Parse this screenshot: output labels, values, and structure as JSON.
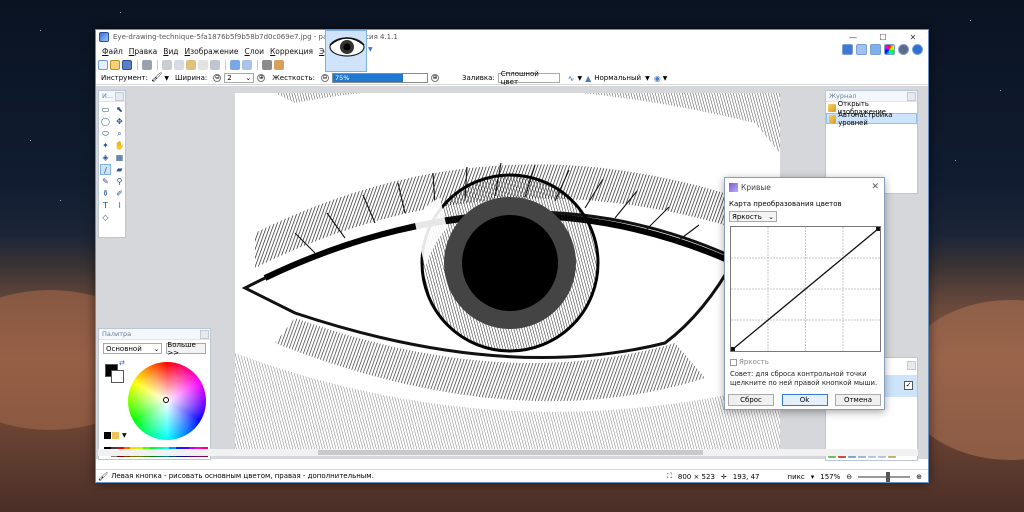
{
  "window": {
    "title": "Eye-drawing-technique-5fa1876b5f9b58b7d0c069e7.jpg - paint.net версия 4.1.1",
    "minimize": "—",
    "maximize": "☐",
    "close": "✕"
  },
  "menu": [
    "Файл",
    "Правка",
    "Вид",
    "Изображение",
    "Слои",
    "Коррекция",
    "Эффекты"
  ],
  "toolbar2": {
    "tool_label": "Инструмент:",
    "width_label": "Ширина:",
    "width_value": "2",
    "hardness_label": "Жесткость:",
    "hardness_value": "75%",
    "hardness_percent": 75,
    "fill_label": "Заливка:",
    "fill_value": "Сплошной цвет",
    "blend_value": "Нормальный",
    "minus": "⊖",
    "plus": "⊕"
  },
  "tools_panel": {
    "title": "И..."
  },
  "palette": {
    "title": "Палитра",
    "mode": "Основной",
    "more_button": "Больше >>",
    "primary_color": "#000000",
    "secondary_color": "#ffffff",
    "swatches": [
      "#000000",
      "#404040",
      "#ff0000",
      "#ff6a00",
      "#ffd800",
      "#b6ff00",
      "#4cff00",
      "#00ff21",
      "#00ff90",
      "#00ffff",
      "#0094ff",
      "#0026ff",
      "#4800ff",
      "#b200ff",
      "#ff00dc",
      "#ff006e",
      "#ffffff",
      "#808080",
      "#7f0000",
      "#7f3300",
      "#7f6a00",
      "#5b7f00",
      "#267f00",
      "#007f0e",
      "#007f46",
      "#007f7f",
      "#004a7f",
      "#00137f",
      "#21007f",
      "#57007f",
      "#7f006e",
      "#7f0037"
    ]
  },
  "history": {
    "title": "Журнал",
    "items": [
      {
        "label": "Открыть изображение",
        "selected": false
      },
      {
        "label": "Автонастройка уровней",
        "selected": true
      }
    ]
  },
  "curves_dialog": {
    "title": "Кривые",
    "section_label": "Карта преобразования цветов",
    "mode": "Яркость",
    "luminosity_check": "Яркость",
    "hint": "Совет: для сброса контрольной точки щелкните по ней правой кнопкой мыши.",
    "reset_button": "Сброс",
    "ok_button": "Ok",
    "cancel_button": "Отмена"
  },
  "status": {
    "hint": "Левая кнопка - рисовать основным цветом, правая - дополнительным.",
    "image_size": "800 × 523",
    "cursor_pos": "193, 47",
    "units": "пикс",
    "zoom": "157%"
  },
  "colors": {
    "accent": "#1e78d0",
    "selection": "#cde4fb"
  }
}
